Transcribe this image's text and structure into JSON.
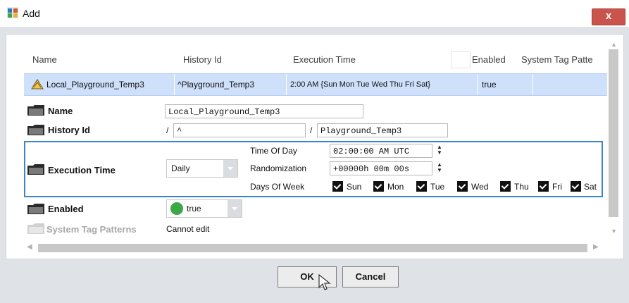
{
  "window": {
    "title": "Add",
    "close_label": "x"
  },
  "table": {
    "headers": [
      "Name",
      "History Id",
      "Execution Time",
      "Enabled",
      "System Tag Patte"
    ],
    "row": {
      "name": "Local_Playground_Temp3",
      "history_id": "^Playground_Temp3",
      "execution_time": "2:00 AM {Sun Mon Tue Wed Thu Fri Sat}",
      "enabled": "true"
    }
  },
  "form": {
    "name": {
      "label": "Name",
      "value": "Local_Playground_Temp3"
    },
    "history_id": {
      "label": "History Id",
      "sep1": "/",
      "prefix": "^",
      "sep2": "/",
      "value": "Playground_Temp3"
    },
    "execution_time": {
      "label": "Execution Time",
      "mode": "Daily",
      "time_of_day_label": "Time Of Day",
      "time_of_day": "02:00:00 AM UTC",
      "randomization_label": "Randomization",
      "randomization": "+00000h 00m 00s",
      "days_label": "Days Of Week",
      "days": [
        "Sun",
        "Mon",
        "Tue",
        "Wed",
        "Thu",
        "Fri",
        "Sat"
      ]
    },
    "enabled": {
      "label": "Enabled",
      "value": "true",
      "dot_color": "#3aa845"
    },
    "system_tag_patterns": {
      "label": "System Tag Patterns",
      "value": "Cannot edit"
    }
  },
  "buttons": {
    "ok": "OK",
    "cancel": "Cancel"
  },
  "colors": {
    "selection": "#cfe0fb",
    "focus_border": "#3b87c3",
    "close": "#c9544b"
  }
}
